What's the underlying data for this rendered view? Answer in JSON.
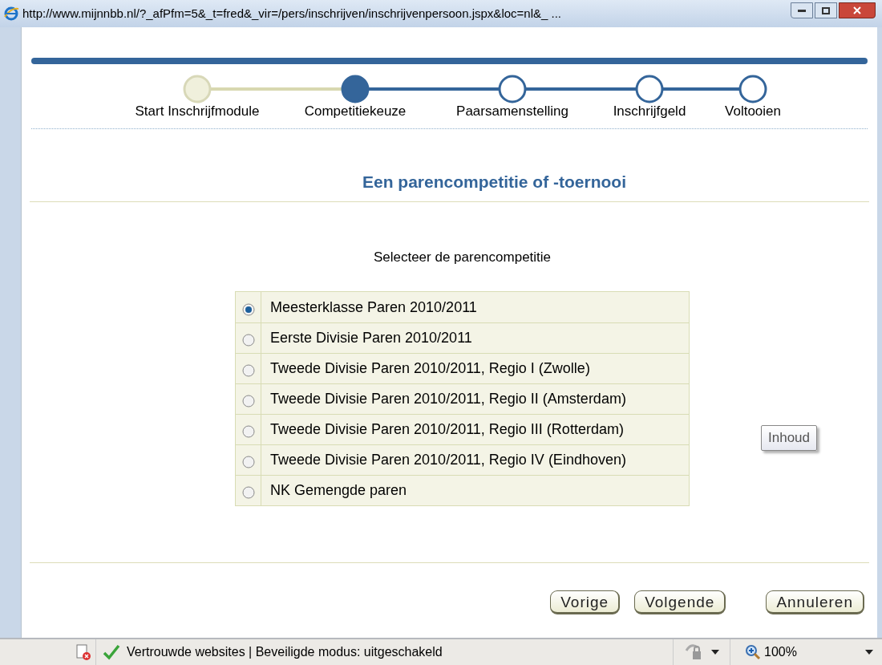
{
  "window": {
    "title": "http://www.mijnnbb.nl/?_afPfm=5&_t=fred&_vir=/pers/inschrijven/inschrijvenpersoon.jspx&loc=nl&_ ..."
  },
  "steps": [
    {
      "label": "Start Inschrijfmodule",
      "completed": true,
      "selected": false
    },
    {
      "label": "Competitiekeuze",
      "completed": false,
      "selected": true
    },
    {
      "label": "Paarsamenstelling",
      "completed": false,
      "selected": false
    },
    {
      "label": "Inschrijfgeld",
      "completed": false,
      "selected": false
    },
    {
      "label": "Voltooien",
      "completed": false,
      "selected": false
    }
  ],
  "heading": "Een parencompetitie of -toernooi",
  "prompt": "Selecteer de parencompetitie",
  "options": [
    {
      "label": "Meesterklasse Paren 2010/2011",
      "selected": true
    },
    {
      "label": "Eerste Divisie Paren 2010/2011",
      "selected": false
    },
    {
      "label": "Tweede Divisie Paren 2010/2011, Regio I (Zwolle)",
      "selected": false
    },
    {
      "label": "Tweede Divisie Paren 2010/2011, Regio II (Amsterdam)",
      "selected": false
    },
    {
      "label": "Tweede Divisie Paren 2010/2011, Regio III (Rotterdam)",
      "selected": false
    },
    {
      "label": "Tweede Divisie Paren 2010/2011, Regio IV (Eindhoven)",
      "selected": false
    },
    {
      "label": "NK Gemengde paren",
      "selected": false
    }
  ],
  "tooltip": "Inhoud",
  "buttons": [
    "Vorige",
    "Volgende",
    "Annuleren"
  ],
  "status_bar": {
    "zone": "Vertrouwde websites | Beveiligde modus: uitgeschakeld",
    "zoom": "100%"
  }
}
